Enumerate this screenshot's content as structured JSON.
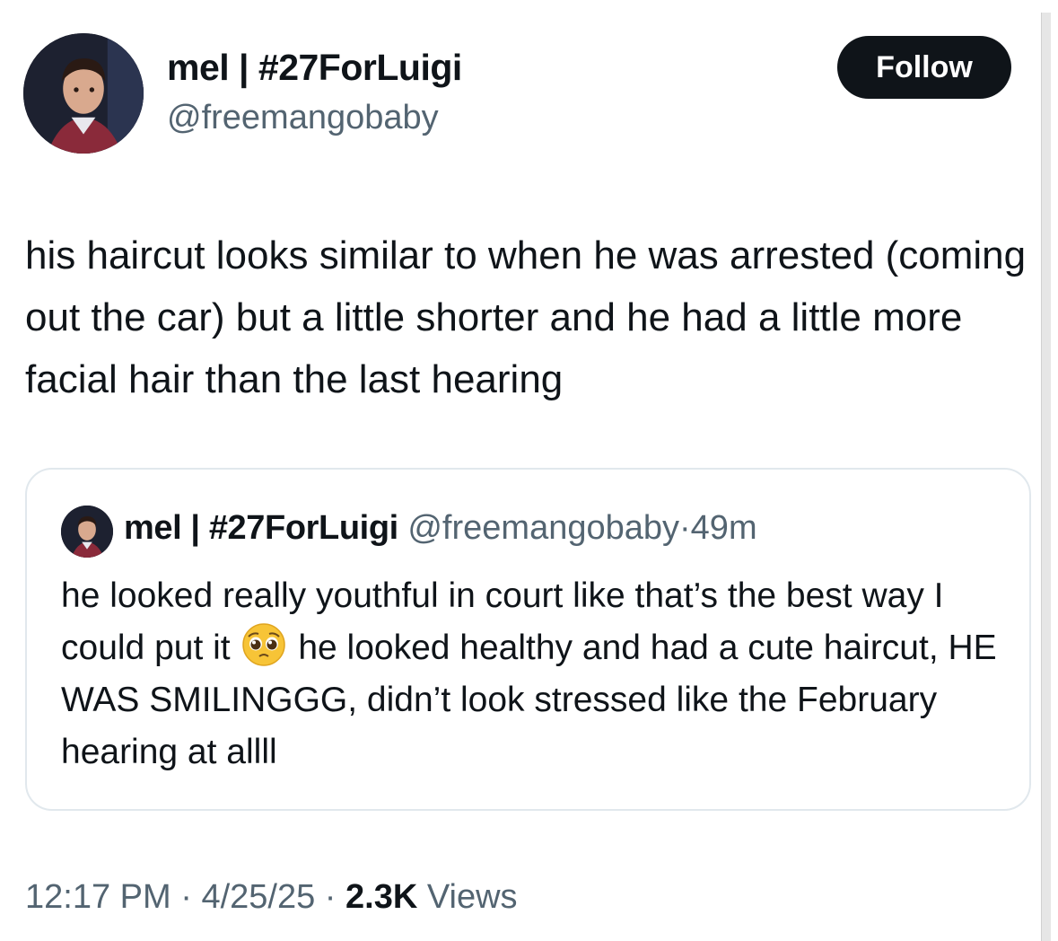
{
  "author": {
    "name": "mel | #27ForLuigi",
    "handle": "@freemangobaby"
  },
  "follow_label": "Follow",
  "tweet": {
    "text": "his haircut looks similar to when he was arrested (coming out the car) but a little shorter and he had a little more facial hair than the last hearing"
  },
  "quote": {
    "name": "mel | #27ForLuigi",
    "handle": "@freemangobaby",
    "separator": "·",
    "time": "49m",
    "text_before_emoji": "he looked really youthful in court like that’s the best way I could put it",
    "emoji": "pleading-face-emoji",
    "text_after_emoji": "he looked healthy and had a cute haircut, HE WAS SMILINGGG, didn’t look stressed like the February hearing at allll"
  },
  "meta": {
    "time": "12:17 PM",
    "sep1": "·",
    "date": "4/25/25",
    "sep2": "·",
    "views_count": "2.3K",
    "views_label": "Views"
  },
  "colors": {
    "text": "#0f1419",
    "secondary": "#536471",
    "follow_bg": "#0f1419",
    "border": "#e1e8ed"
  }
}
